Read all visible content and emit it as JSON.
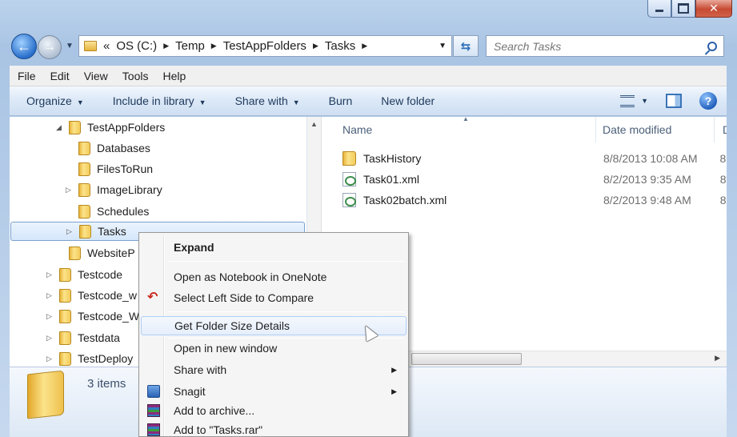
{
  "address": {
    "segments": [
      "«",
      "OS (C:)",
      "Temp",
      "TestAppFolders",
      "Tasks"
    ]
  },
  "search": {
    "placeholder": "Search Tasks"
  },
  "menu": {
    "items": [
      "File",
      "Edit",
      "View",
      "Tools",
      "Help"
    ]
  },
  "commands": {
    "organize": "Organize",
    "include_library": "Include in library",
    "share_with": "Share with",
    "burn": "Burn",
    "new_folder": "New folder"
  },
  "tree": {
    "items": [
      {
        "label": "TestAppFolders",
        "expander": "◢"
      },
      {
        "label": "Databases",
        "expander": ""
      },
      {
        "label": "FilesToRun",
        "expander": ""
      },
      {
        "label": "ImageLibrary",
        "expander": "▷"
      },
      {
        "label": "Schedules",
        "expander": ""
      },
      {
        "label": "Tasks",
        "expander": "▷"
      },
      {
        "label": "WebsiteP",
        "expander": ""
      },
      {
        "label": "Testcode",
        "expander": "▷"
      },
      {
        "label": "Testcode_w",
        "expander": "▷"
      },
      {
        "label": "Testcode_W",
        "expander": "▷"
      },
      {
        "label": "Testdata",
        "expander": "▷"
      },
      {
        "label": "TestDeploy",
        "expander": "▷"
      }
    ]
  },
  "columns": {
    "name": "Name",
    "date": "Date modified",
    "extra": "D"
  },
  "files": [
    {
      "name": "TaskHistory",
      "date": "8/8/2013 10:08 AM",
      "type": "folder",
      "extra": "8"
    },
    {
      "name": "Task01.xml",
      "date": "8/2/2013 9:35 AM",
      "type": "xml",
      "extra": "8"
    },
    {
      "name": "Task02batch.xml",
      "date": "8/2/2013 9:48 AM",
      "type": "xml",
      "extra": "8"
    }
  ],
  "details": {
    "count": "3 items"
  },
  "context_menu": {
    "expand": "Expand",
    "open_onenote": "Open as Notebook in OneNote",
    "select_left": "Select Left Side to Compare",
    "folder_size": "Get Folder Size Details",
    "open_new_window": "Open in new window",
    "share_with": "Share with",
    "snagit": "Snagit",
    "add_archive": "Add to archive...",
    "add_rar": "Add to \"Tasks.rar\""
  },
  "colors": {
    "accent": "#3a74b8",
    "selection": "#d5e7fb",
    "hover_border": "#aecff7"
  }
}
